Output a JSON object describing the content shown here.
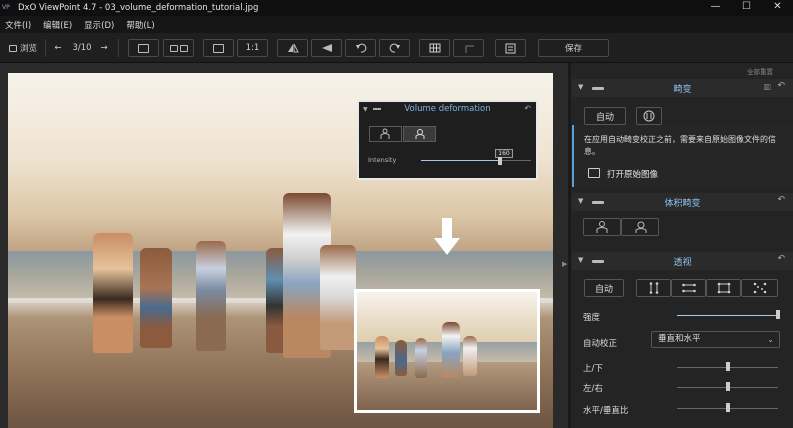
{
  "window": {
    "logo": "VP",
    "title": "DxO ViewPoint 4.7 - 03_volume_deformation_tutorial.jpg",
    "minimize": "—",
    "maximize": "☐",
    "close": "✕"
  },
  "menu": [
    "文件(I)",
    "编辑(E)",
    "显示(D)",
    "帮助(L)"
  ],
  "toolbar": {
    "browse_label": "浏览",
    "prev": "←",
    "counter": "3/10",
    "next": "→",
    "zoom_label": "1:1",
    "save_label": "保存"
  },
  "photo_overlay": {
    "panel_title": "Volume deformation",
    "intensity_label": "Intensity",
    "intensity_value": "160",
    "intensity_fraction": 0.72
  },
  "panel": {
    "reset_all": "全部重置",
    "sections": [
      {
        "name": "畸变",
        "auto_label": "自动",
        "info_text": "在应用自动畸变校正之前，需要来自原始图像文件的信息。",
        "open_original_label": "打开原始图像"
      },
      {
        "name": "体积畸变"
      },
      {
        "name": "透视",
        "auto_label": "自动",
        "rows": [
          {
            "label": "强度",
            "value_fraction": 1.0
          },
          {
            "label": "自动校正",
            "select_value": "垂直和水平"
          },
          {
            "label": "上/下",
            "value_fraction": 0.5
          },
          {
            "label": "左/右",
            "value_fraction": 0.5
          },
          {
            "label": "水平/垂直比",
            "value_fraction": 0.5
          }
        ]
      }
    ]
  },
  "colors": {
    "accent": "#8cc0ee",
    "panel_bg": "#242424",
    "toolbar_bg": "#1f1f1f"
  }
}
